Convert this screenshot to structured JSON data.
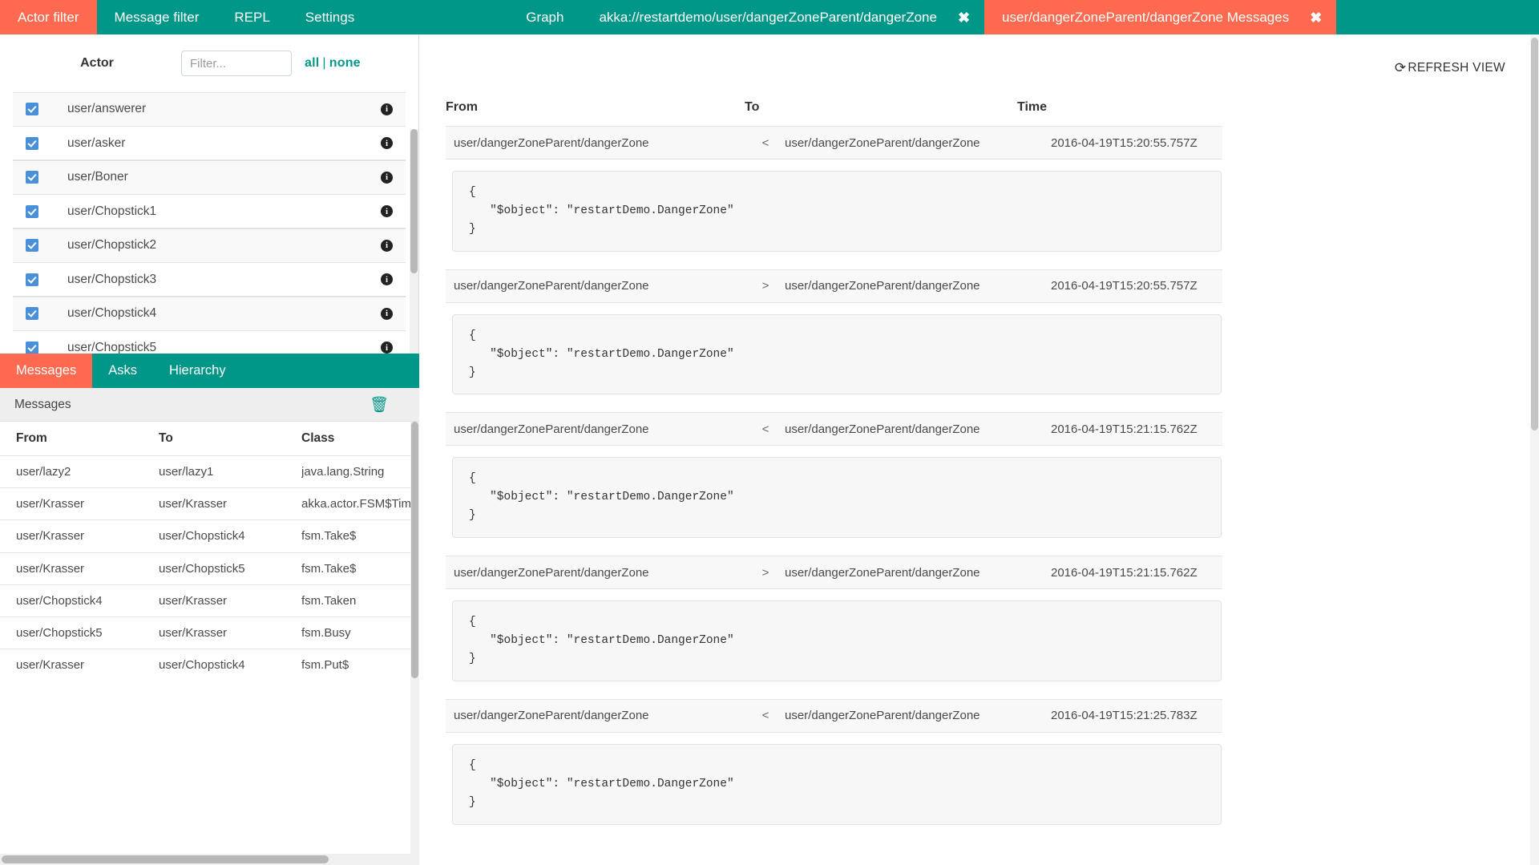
{
  "topbar": {
    "menu": [
      {
        "label": "Actor filter",
        "active": true
      },
      {
        "label": "Message filter",
        "active": false
      },
      {
        "label": "REPL",
        "active": false
      },
      {
        "label": "Settings",
        "active": false
      },
      {
        "label": "Graph",
        "active": false
      }
    ],
    "tabs": [
      {
        "label": "akka://restartdemo/user/dangerZoneParent/dangerZone",
        "active": false,
        "close": "✖"
      },
      {
        "label": "user/dangerZoneParent/dangerZone Messages",
        "active": true,
        "close": "✖"
      }
    ]
  },
  "actor_filter": {
    "title": "Actor",
    "search_placeholder": "Filter...",
    "search_value": "",
    "select_all": "all",
    "separator": "|",
    "select_none": "none",
    "info_icon_glyph": "i",
    "rows": [
      {
        "name": "user/answerer",
        "checked": true
      },
      {
        "name": "user/asker",
        "checked": true
      },
      {
        "name": "user/Boner",
        "checked": true
      },
      {
        "name": "user/Chopstick1",
        "checked": true
      },
      {
        "name": "user/Chopstick2",
        "checked": true
      },
      {
        "name": "user/Chopstick3",
        "checked": true
      },
      {
        "name": "user/Chopstick4",
        "checked": true
      },
      {
        "name": "user/Chopstick5",
        "checked": true
      }
    ]
  },
  "messages_panel": {
    "tabs": [
      {
        "label": "Messages",
        "active": true
      },
      {
        "label": "Asks",
        "active": false
      },
      {
        "label": "Hierarchy",
        "active": false
      }
    ],
    "subheader": "Messages",
    "clear_icon": "🗑",
    "columns": [
      "From",
      "To",
      "Class"
    ],
    "rows": [
      {
        "from": "user/lazy2",
        "to": "user/lazy1",
        "cls": "java.lang.String"
      },
      {
        "from": "user/Krasser",
        "to": "user/Krasser",
        "cls": "akka.actor.FSM$Tim"
      },
      {
        "from": "user/Krasser",
        "to": "user/Chopstick4",
        "cls": "fsm.Take$"
      },
      {
        "from": "user/Krasser",
        "to": "user/Chopstick5",
        "cls": "fsm.Take$"
      },
      {
        "from": "user/Chopstick4",
        "to": "user/Krasser",
        "cls": "fsm.Taken"
      },
      {
        "from": "user/Chopstick5",
        "to": "user/Krasser",
        "cls": "fsm.Busy"
      },
      {
        "from": "user/Krasser",
        "to": "user/Chopstick4",
        "cls": "fsm.Put$"
      }
    ]
  },
  "conversation": {
    "refresh_label": "REFRESH VIEW",
    "refresh_icon": "⟳",
    "columns": {
      "from": "From",
      "to": "To",
      "time": "Time"
    },
    "entries": [
      {
        "from": "user/dangerZoneParent/dangerZone",
        "direction": "<",
        "to": "user/dangerZoneParent/dangerZone",
        "time": "2016-04-19T15:20:55.757Z",
        "body": "{\n   \"$object\": \"restartDemo.DangerZone\"\n}"
      },
      {
        "from": "user/dangerZoneParent/dangerZone",
        "direction": ">",
        "to": "user/dangerZoneParent/dangerZone",
        "time": "2016-04-19T15:20:55.757Z",
        "body": "{\n   \"$object\": \"restartDemo.DangerZone\"\n}"
      },
      {
        "from": "user/dangerZoneParent/dangerZone",
        "direction": "<",
        "to": "user/dangerZoneParent/dangerZone",
        "time": "2016-04-19T15:21:15.762Z",
        "body": "{\n   \"$object\": \"restartDemo.DangerZone\"\n}"
      },
      {
        "from": "user/dangerZoneParent/dangerZone",
        "direction": ">",
        "to": "user/dangerZoneParent/dangerZone",
        "time": "2016-04-19T15:21:15.762Z",
        "body": "{\n   \"$object\": \"restartDemo.DangerZone\"\n}"
      },
      {
        "from": "user/dangerZoneParent/dangerZone",
        "direction": "<",
        "to": "user/dangerZoneParent/dangerZone",
        "time": "2016-04-19T15:21:25.783Z",
        "body": "{\n   \"$object\": \"restartDemo.DangerZone\"\n}"
      }
    ]
  },
  "colors": {
    "brand_teal": "#009688",
    "accent_orange": "#fd6a4f",
    "checkbox_blue": "#4a90d9"
  }
}
